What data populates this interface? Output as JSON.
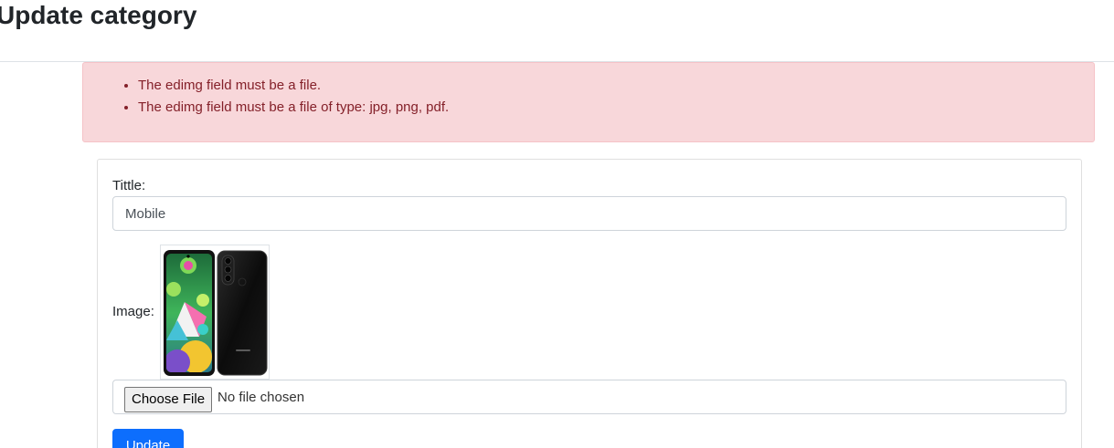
{
  "page": {
    "title": "Update category"
  },
  "alert": {
    "errors": [
      "The edimg field must be a file.",
      "The edimg field must be a file of type: jpg, png, pdf."
    ]
  },
  "form": {
    "title_label": "Tittle:",
    "title_value": "Mobile",
    "image_label": "Image:",
    "file_button_label": "Choose File",
    "file_status": "No file chosen",
    "submit_label": "Update"
  },
  "colors": {
    "alert_bg": "#f8d7da",
    "alert_text": "#842029",
    "primary": "#0d6efd"
  }
}
